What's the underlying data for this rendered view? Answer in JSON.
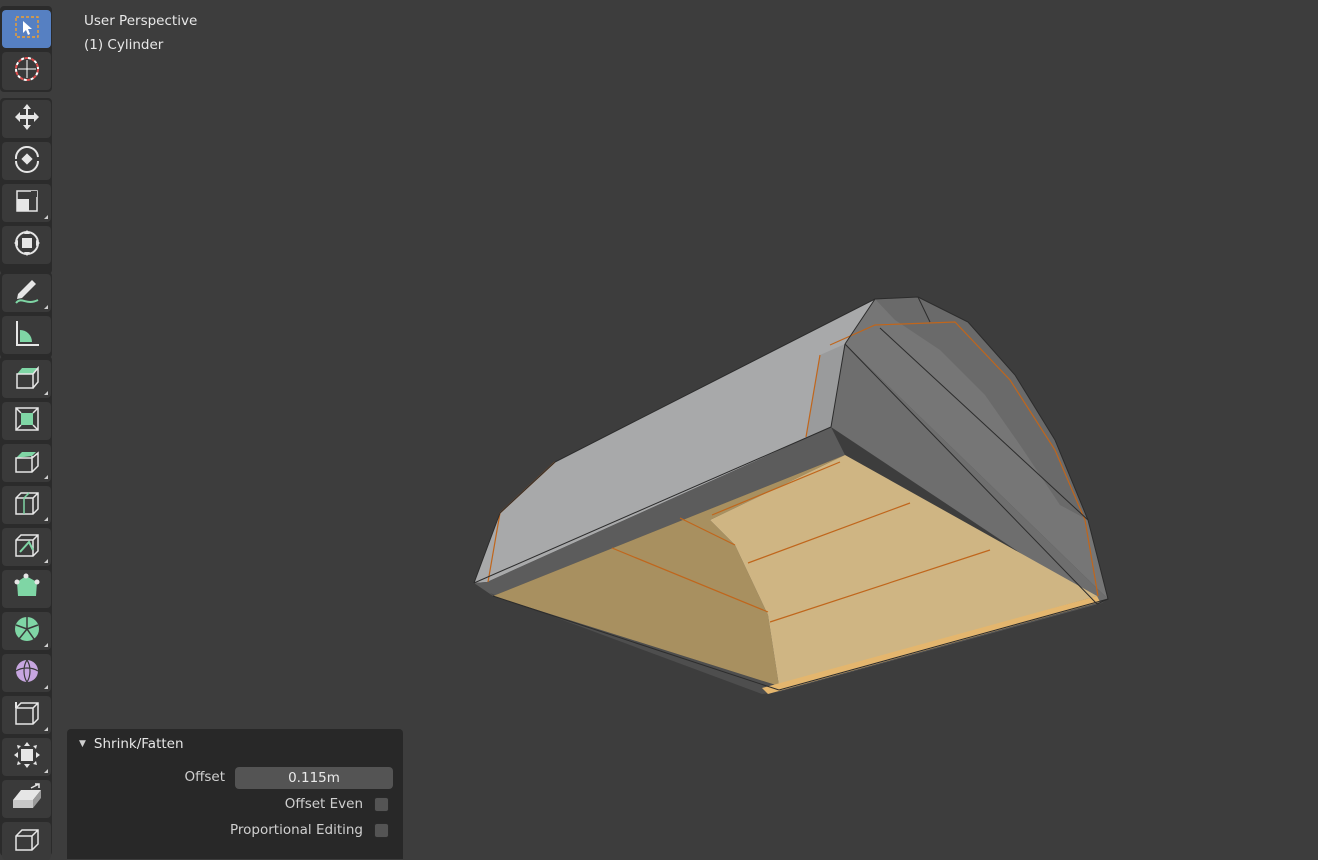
{
  "viewport": {
    "view_name": "User Perspective",
    "object_name": "(1) Cylinder",
    "background_color": "#3d3d3d",
    "selection_color": "#e58d26",
    "selected_face_color": "#d4b178",
    "mesh_color": "#a4a4a4"
  },
  "toolbar": {
    "tools": [
      {
        "name": "select-box",
        "icon": "select-box-icon",
        "active": true
      },
      {
        "name": "cursor",
        "icon": "cursor-icon",
        "active": false
      },
      {
        "name": "move",
        "icon": "move-icon",
        "active": false
      },
      {
        "name": "rotate",
        "icon": "rotate-icon",
        "active": false
      },
      {
        "name": "scale",
        "icon": "scale-icon",
        "active": false
      },
      {
        "name": "transform",
        "icon": "transform-icon",
        "active": false
      },
      {
        "name": "annotate",
        "icon": "annotate-icon",
        "active": false
      },
      {
        "name": "measure",
        "icon": "measure-icon",
        "active": false
      },
      {
        "name": "extrude-region",
        "icon": "extrude-region-icon",
        "active": false
      },
      {
        "name": "inset-faces",
        "icon": "inset-faces-icon",
        "active": false
      },
      {
        "name": "bevel",
        "icon": "bevel-icon",
        "active": false
      },
      {
        "name": "loop-cut",
        "icon": "loop-cut-icon",
        "active": false
      },
      {
        "name": "knife",
        "icon": "knife-icon",
        "active": false
      },
      {
        "name": "poly-build",
        "icon": "poly-build-icon",
        "active": false
      },
      {
        "name": "spin",
        "icon": "spin-icon",
        "active": false
      },
      {
        "name": "smooth",
        "icon": "smooth-icon",
        "active": false
      },
      {
        "name": "edge-slide",
        "icon": "edge-slide-icon",
        "active": false
      },
      {
        "name": "shrink-fatten",
        "icon": "shrink-fatten-icon",
        "active": false
      },
      {
        "name": "shear",
        "icon": "shear-icon",
        "active": false
      },
      {
        "name": "rip-region",
        "icon": "rip-region-icon",
        "active": false
      }
    ]
  },
  "redo_panel": {
    "title": "Shrink/Fatten",
    "offset_label": "Offset",
    "offset_value": "0.115m",
    "offset_even_label": "Offset Even",
    "offset_even_checked": false,
    "proportional_label": "Proportional Editing",
    "proportional_checked": false
  }
}
